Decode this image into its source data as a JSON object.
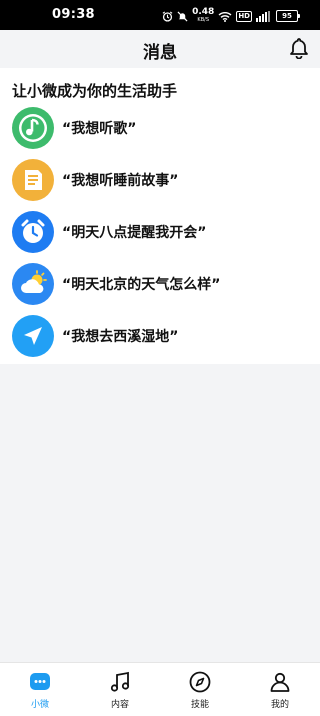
{
  "status_bar": {
    "time": "09:38",
    "net_speed": "0.48",
    "net_unit": "KB/S",
    "network_label": "HD",
    "battery": "95"
  },
  "header": {
    "title": "消息"
  },
  "card": {
    "intro": "让小微成为你的生活助手",
    "suggestions": [
      {
        "text": "“我想听歌”",
        "icon": "music-note-icon",
        "color": "#3dbb6c"
      },
      {
        "text": "“我想听睡前故事”",
        "icon": "document-icon",
        "color": "#f2b13a"
      },
      {
        "text": "“明天八点提醒我开会”",
        "icon": "alarm-clock-icon",
        "color": "#1e7cf2"
      },
      {
        "text": "“明天北京的天气怎么样”",
        "icon": "weather-icon",
        "color": "#2b88f2"
      },
      {
        "text": "“我想去西溪湿地”",
        "icon": "navigation-icon",
        "color": "#22a0f5"
      }
    ]
  },
  "tabbar": {
    "items": [
      {
        "label": "小微",
        "active": true
      },
      {
        "label": "内容",
        "active": false
      },
      {
        "label": "技能",
        "active": false
      },
      {
        "label": "我的",
        "active": false
      }
    ],
    "accent": "#1c9bf0"
  }
}
